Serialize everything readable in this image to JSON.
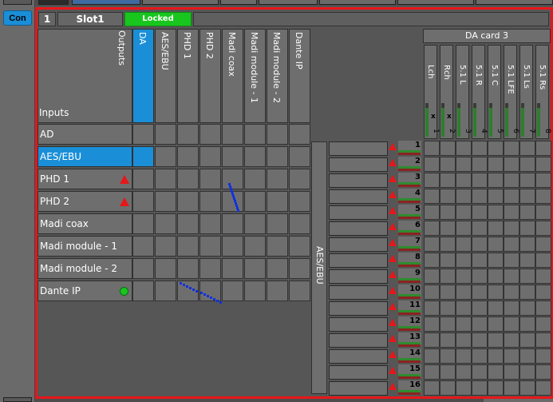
{
  "sidebar": {
    "con_label": "Con"
  },
  "slot": {
    "number": "1",
    "name": "Slot1",
    "status": "Locked"
  },
  "matrix": {
    "outputs_label": "Outputs",
    "inputs_label": "Inputs",
    "outputs": [
      "DA",
      "AES/EBU",
      "PHD 1",
      "PHD 2",
      "Madi coax",
      "Madi module - 1",
      "Madi module - 2",
      "Dante IP"
    ],
    "inputs": [
      {
        "label": "AD",
        "status": "none"
      },
      {
        "label": "AES/EBU",
        "status": "none"
      },
      {
        "label": "PHD 1",
        "status": "warning"
      },
      {
        "label": "PHD 2",
        "status": "warning"
      },
      {
        "label": "Madi coax",
        "status": "none"
      },
      {
        "label": "Madi module - 1",
        "status": "none"
      },
      {
        "label": "Madi module - 2",
        "status": "none"
      },
      {
        "label": "Dante IP",
        "status": "ok"
      }
    ],
    "selected_output": "DA",
    "selected_input": "AES/EBU"
  },
  "da_card": {
    "title": "DA card 3",
    "channels": [
      {
        "name": "Lch",
        "num": "1",
        "x": "x"
      },
      {
        "name": "Rch",
        "num": "2",
        "x": "x"
      },
      {
        "name": "5.1 L",
        "num": "3",
        "x": ""
      },
      {
        "name": "5.1 R",
        "num": "4",
        "x": ""
      },
      {
        "name": "5.1 C",
        "num": "5",
        "x": ""
      },
      {
        "name": "5.1 LFE",
        "num": "6",
        "x": ""
      },
      {
        "name": "5.1 Ls",
        "num": "7",
        "x": ""
      },
      {
        "name": "5.1 Rs",
        "num": "8",
        "x": ""
      }
    ]
  },
  "aes_source": {
    "label": "AES/EBU",
    "channels": [
      "1",
      "2",
      "3",
      "4",
      "5",
      "6",
      "7",
      "8",
      "9",
      "10",
      "11",
      "12",
      "13",
      "14",
      "15",
      "16"
    ]
  },
  "colors": {
    "accent": "#1a8fd8",
    "locked": "#18c61e",
    "alert": "#e8161a",
    "crosspoint": "#1230e0"
  }
}
